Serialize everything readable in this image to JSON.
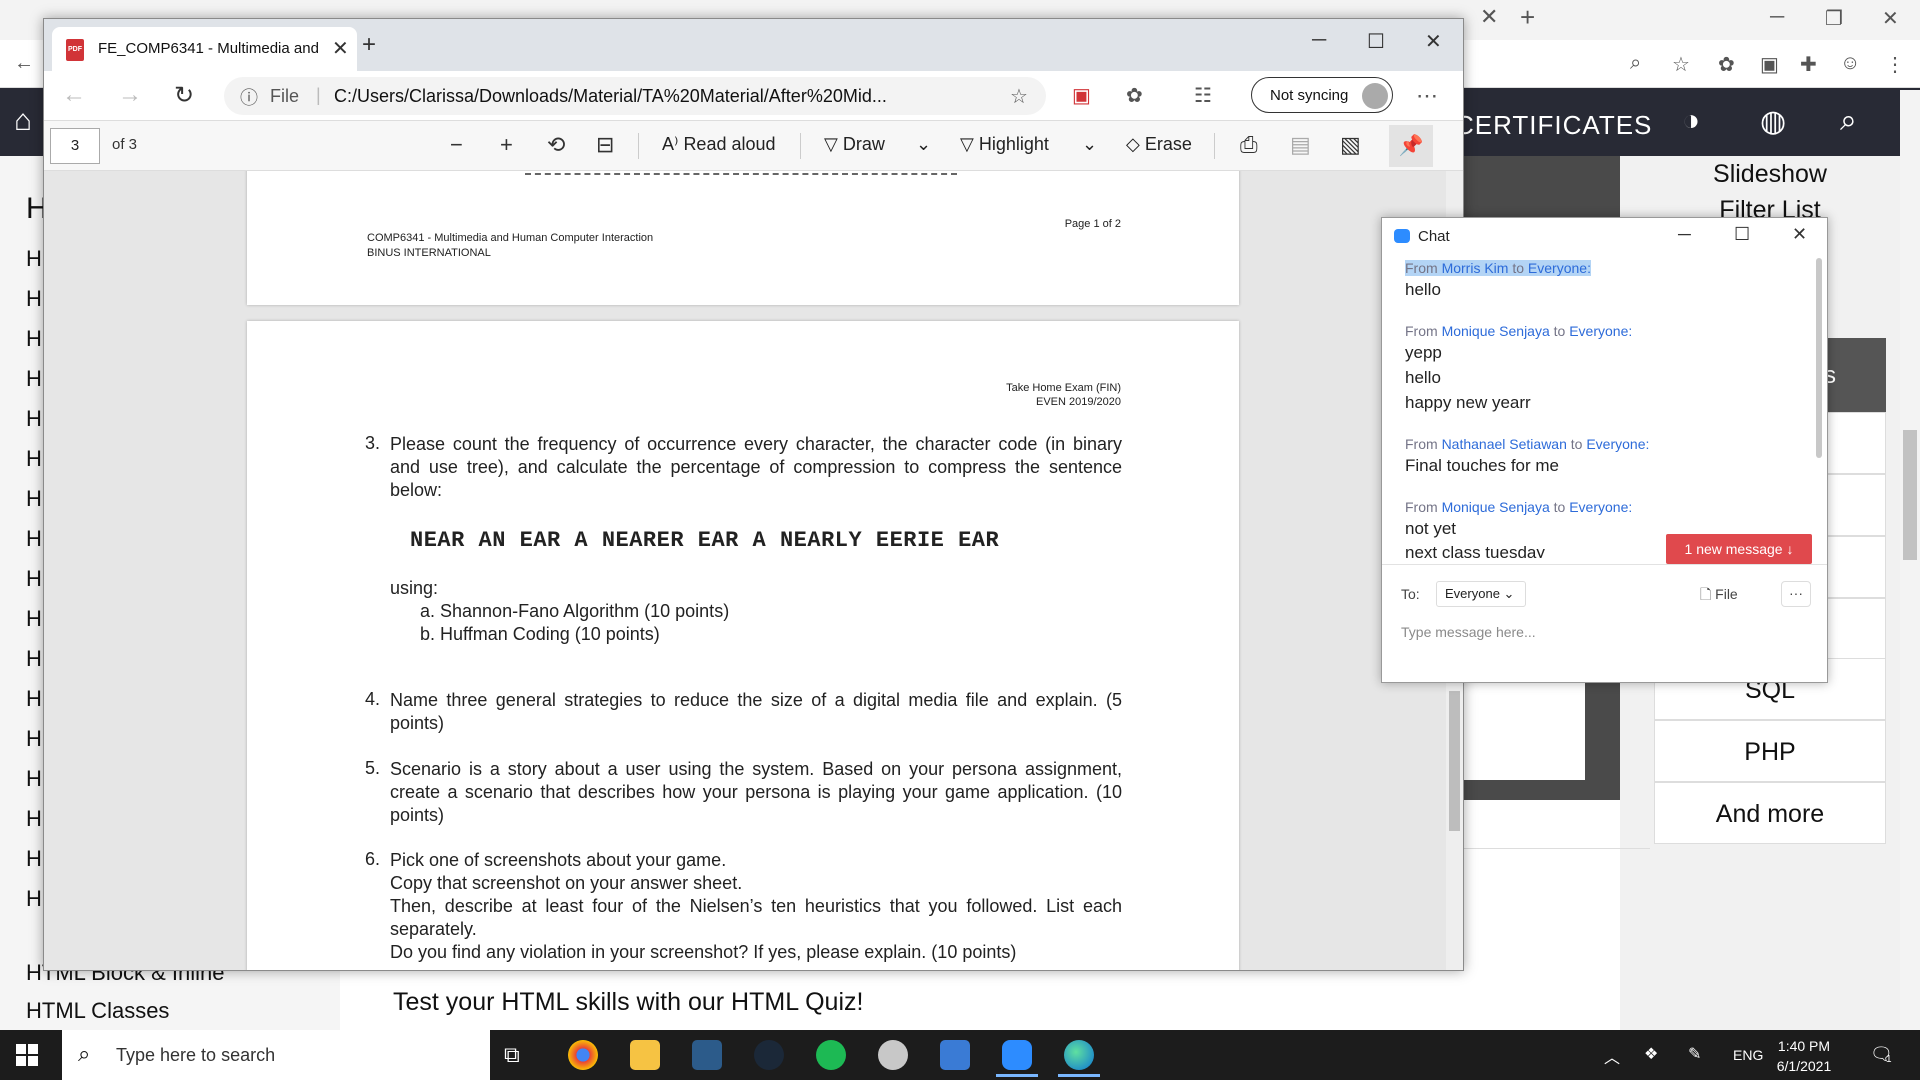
{
  "bg_browser": {
    "nav_cert_label": "CERTIFICATES",
    "left_heading": "H",
    "left_items": [
      "HTML Block & Inline",
      "HTML Classes"
    ],
    "left_h_stub": "H",
    "right_items": [
      "Slideshow",
      "Filter List",
      "SQL",
      "PHP",
      "And more"
    ],
    "dark_tab_stub": "s",
    "quiz_text": "Test your HTML skills with our HTML Quiz!"
  },
  "pdf_window": {
    "tab_title": "FE_COMP6341 - Multimedia and",
    "address": {
      "scheme_label": "File",
      "path": "C:/Users/Clarissa/Downloads/Material/TA%20Material/After%20Mid...",
      "sync_label": "Not syncing"
    },
    "toolbar": {
      "page_current": "3",
      "page_total": "of 3",
      "read_aloud": "Read aloud",
      "draw": "Draw",
      "highlight": "Highlight",
      "erase": "Erase"
    },
    "page1": {
      "page_number": "Page 1 of 2",
      "course": "COMP6341 - Multimedia and Human Computer Interaction",
      "institution": "BINUS INTERNATIONAL"
    },
    "page3": {
      "exam_title": "Take Home Exam (FIN)",
      "exam_term": "EVEN 2019/2020",
      "q3_num": "3.",
      "q3_text": "Please count the frequency of occurrence every character, the character code (in binary and use tree), and calculate the percentage of compression to compress the sentence below:",
      "q3_sentence": "NEAR AN EAR A NEARER EAR A NEARLY EERIE EAR",
      "q3_using": "using:",
      "q3_a": "a. Shannon-Fano Algorithm (10 points)",
      "q3_b": "b. Huffman Coding (10 points)",
      "q4_num": "4.",
      "q4_text": "Name three general strategies to reduce the size of a digital media file and explain. (5 points)",
      "q5_num": "5.",
      "q5_text": "Scenario is a story about a user using the system. Based on your persona assignment, create a scenario that describes how your persona is playing your game application.  (10 points)",
      "q6_num": "6.",
      "q6_lines": [
        "Pick one of screenshots about your game.",
        "Copy that screenshot on your answer sheet.",
        "Then, describe at least four of the Nielsen’s ten heuristics that you followed. List each separately.",
        "Do you find any violation in your screenshot? If yes, please explain. (10 points)"
      ]
    }
  },
  "chat": {
    "title": "Chat",
    "messages": [
      {
        "from_prefix": "From",
        "sender": "Morris Kim",
        "to_word": "to",
        "recipient": "Everyone:",
        "lines": [
          "hello"
        ]
      },
      {
        "from_prefix": "From",
        "sender": "Monique Senjaya",
        "to_word": "to",
        "recipient": "Everyone:",
        "lines": [
          "yepp",
          "hello",
          "happy new yearr"
        ]
      },
      {
        "from_prefix": "From",
        "sender": "Nathanael Setiawan",
        "to_word": "to",
        "recipient": "Everyone:",
        "lines": [
          "Final touches for me"
        ]
      },
      {
        "from_prefix": "From",
        "sender": "Monique Senjaya",
        "to_word": "to",
        "recipient": "Everyone:",
        "lines": [
          "not yet",
          "next class tuesday"
        ]
      }
    ],
    "new_message_label": "1 new message",
    "to_label": "To:",
    "to_value": "Everyone",
    "file_label": "File",
    "input_placeholder": "Type message here..."
  },
  "taskbar": {
    "search_placeholder": "Type here to search",
    "language": "ENG",
    "time": "1:40 PM",
    "date": "6/1/2021",
    "notification_count": "1"
  },
  "colors": {
    "chat_link_blue": "#2d6bd9",
    "new_message_red": "#e0494d",
    "nav_dark": "#282a35",
    "taskbar": "#1c1c1c"
  }
}
